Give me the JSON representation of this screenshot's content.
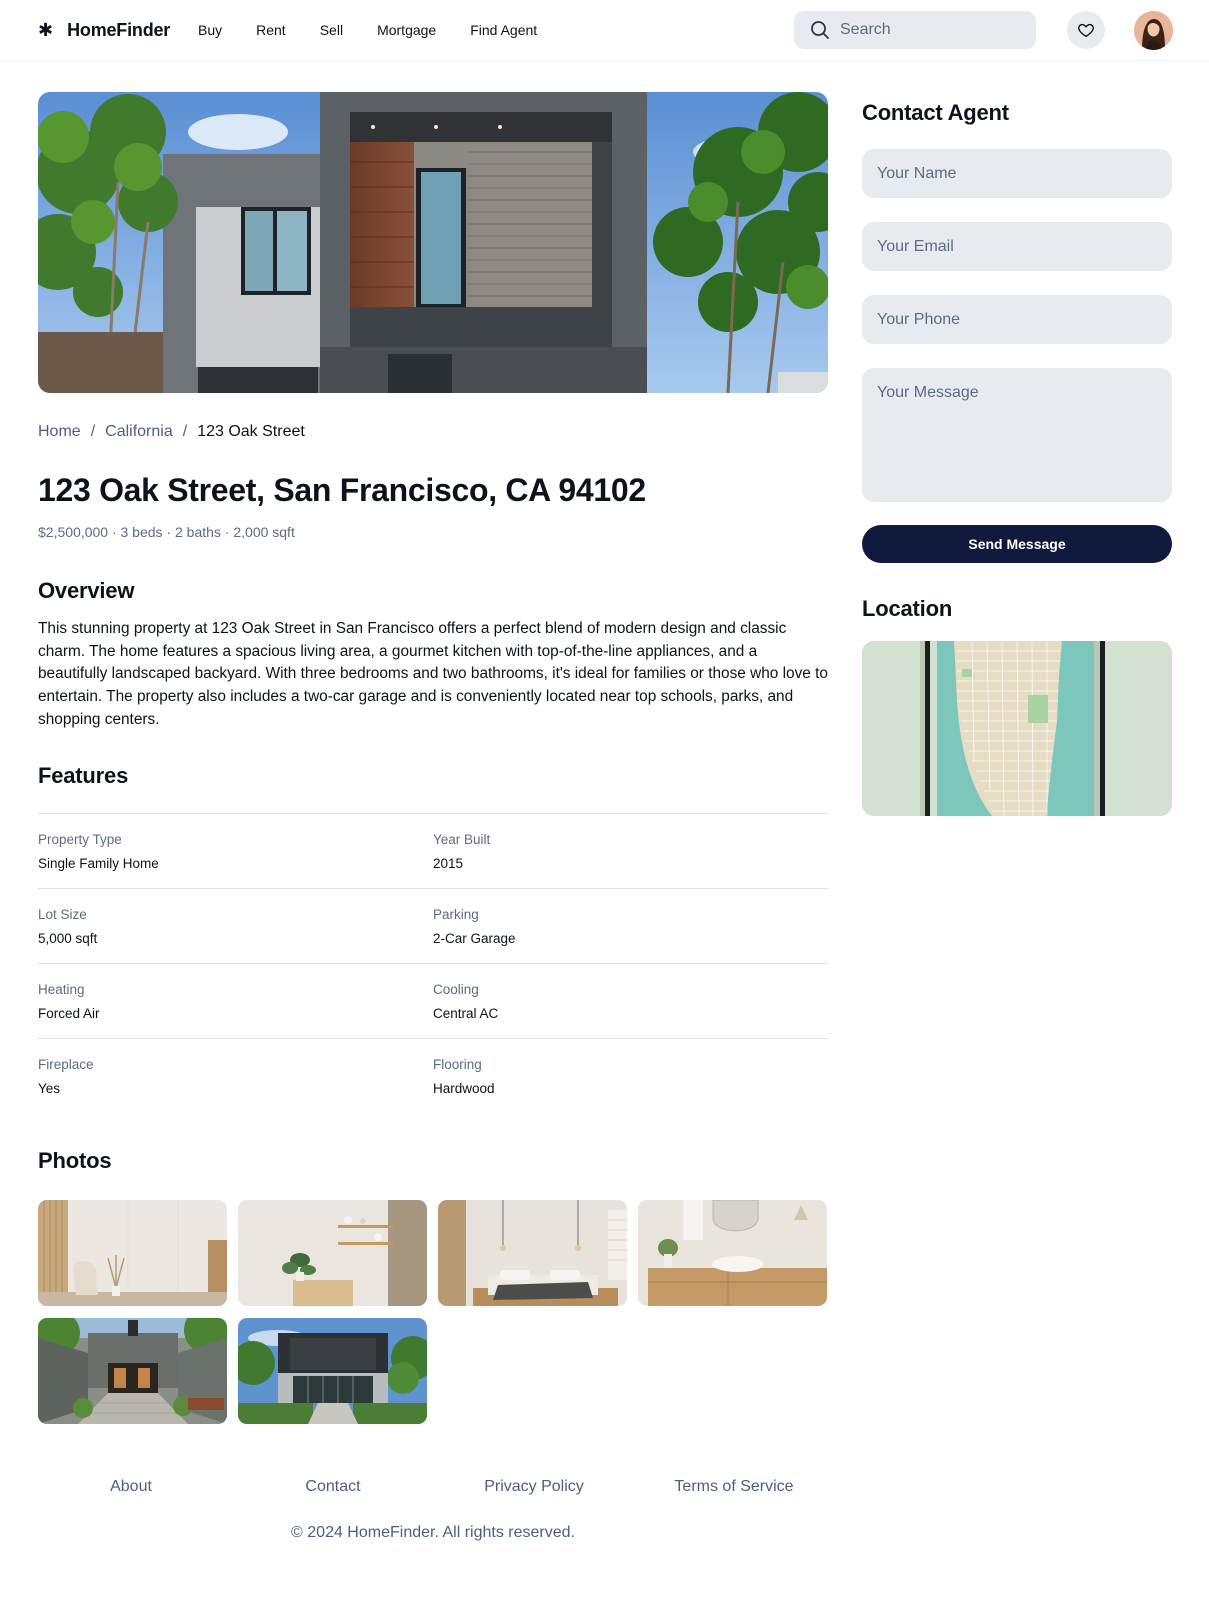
{
  "header": {
    "brand": "HomeFinder",
    "brand_icon": "asterisk-logo-icon",
    "nav": [
      "Buy",
      "Rent",
      "Sell",
      "Mortgage",
      "Find Agent"
    ],
    "search_placeholder": "Search"
  },
  "breadcrumb": {
    "home": "Home",
    "separator": "/",
    "state": "California",
    "current": "123 Oak Street"
  },
  "listing": {
    "title": "123 Oak Street, San Francisco, CA 94102",
    "summary": "$2,500,000 · 3 beds · 2 baths · 2,000 sqft"
  },
  "overview": {
    "heading": "Overview",
    "text": "This stunning property at 123 Oak Street in San Francisco offers a perfect blend of modern design and classic charm. The home features a spacious living area, a gourmet kitchen with top-of-the-line appliances, and a beautifully landscaped backyard. With three bedrooms and two bathrooms, it's ideal for families or those who love to entertain. The property also includes a two-car garage and is conveniently located near top schools, parks, and shopping centers."
  },
  "features": {
    "heading": "Features",
    "rows": [
      [
        {
          "label": "Property Type",
          "value": "Single Family Home"
        },
        {
          "label": "Year Built",
          "value": "2015"
        }
      ],
      [
        {
          "label": "Lot Size",
          "value": "5,000 sqft"
        },
        {
          "label": "Parking",
          "value": "2-Car Garage"
        }
      ],
      [
        {
          "label": "Heating",
          "value": "Forced Air"
        },
        {
          "label": "Cooling",
          "value": "Central AC"
        }
      ],
      [
        {
          "label": "Fireplace",
          "value": "Yes"
        },
        {
          "label": "Flooring",
          "value": "Hardwood"
        }
      ]
    ]
  },
  "photos": {
    "heading": "Photos",
    "items": [
      "living-room-photo",
      "shelf-corner-photo",
      "bedroom-photo",
      "bathroom-photo",
      "courtyard-photo",
      "house-front-photo"
    ]
  },
  "contact": {
    "heading": "Contact Agent",
    "name_placeholder": "Your Name",
    "email_placeholder": "Your Email",
    "phone_placeholder": "Your Phone",
    "message_placeholder": "Your Message",
    "send_label": "Send Message"
  },
  "location": {
    "heading": "Location"
  },
  "footer": {
    "links": [
      "About",
      "Contact",
      "Privacy Policy",
      "Terms of Service"
    ],
    "copyright": "© 2024 HomeFinder. All rights reserved."
  },
  "colors": {
    "primary_button": "#0f1a3c",
    "muted_text": "#5d6b82",
    "link_text": "#4c5f80",
    "field_bg": "#e7eaef"
  }
}
